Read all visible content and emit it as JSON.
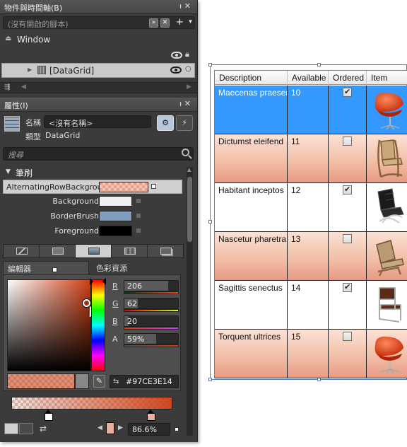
{
  "objects_panel": {
    "title": "物件與時間軸(B)",
    "scope_placeholder": "(沒有開啟的腳本)",
    "window_label": "Window",
    "datagrid_label": "[DataGrid]"
  },
  "properties_panel": {
    "title": "屬性(I)",
    "name_label": "名稱",
    "name_value": "<沒有名稱>",
    "type_label": "類型",
    "type_value": "DataGrid",
    "search_placeholder": "搜尋",
    "brush_section": "筆刷",
    "brushes": [
      {
        "name": "AlternatingRowBackground",
        "color": "#e8a088",
        "selected": true
      },
      {
        "name": "Background",
        "color": "#f0f0f0",
        "selected": false
      },
      {
        "name": "BorderBrush",
        "color": "#7f9dbf",
        "selected": false
      },
      {
        "name": "Foreground",
        "color": "#000000",
        "selected": false
      }
    ],
    "editor_tab": "編輯器",
    "color_resources_tab": "色彩資源",
    "rgba": {
      "r_label": "R",
      "r_value": "206",
      "g_label": "G",
      "g_value": "62",
      "b_label": "B",
      "b_value": "20",
      "a_label": "A",
      "a_value": "59%"
    },
    "hex_value": "#97CE3E14",
    "zoom_value": "86.6%"
  },
  "datagrid": {
    "columns": [
      "Description",
      "Available",
      "Ordered",
      "Item"
    ],
    "rows": [
      {
        "description": "Maecenas praesent",
        "available": "10",
        "ordered": true,
        "chair": "swan-red",
        "selected": true,
        "alt": false
      },
      {
        "description": "Dictumst eleifend",
        "available": "11",
        "ordered": false,
        "chair": "bentwood-tan",
        "selected": false,
        "alt": true
      },
      {
        "description": "Habitant inceptos",
        "available": "12",
        "ordered": true,
        "chair": "barcelona-black",
        "selected": false,
        "alt": false
      },
      {
        "description": "Nascetur pharetra",
        "available": "13",
        "ordered": false,
        "chair": "lounge-tan",
        "selected": false,
        "alt": true
      },
      {
        "description": "Sagittis senectus",
        "available": "14",
        "ordered": true,
        "chair": "cantilever-brown",
        "selected": false,
        "alt": false
      },
      {
        "description": "Torquent ultrices",
        "available": "15",
        "ordered": false,
        "chair": "swan-red",
        "selected": false,
        "alt": true
      }
    ]
  },
  "colors": {
    "selection_blue": "#3399ff",
    "selected_color": "#ce3e14"
  }
}
